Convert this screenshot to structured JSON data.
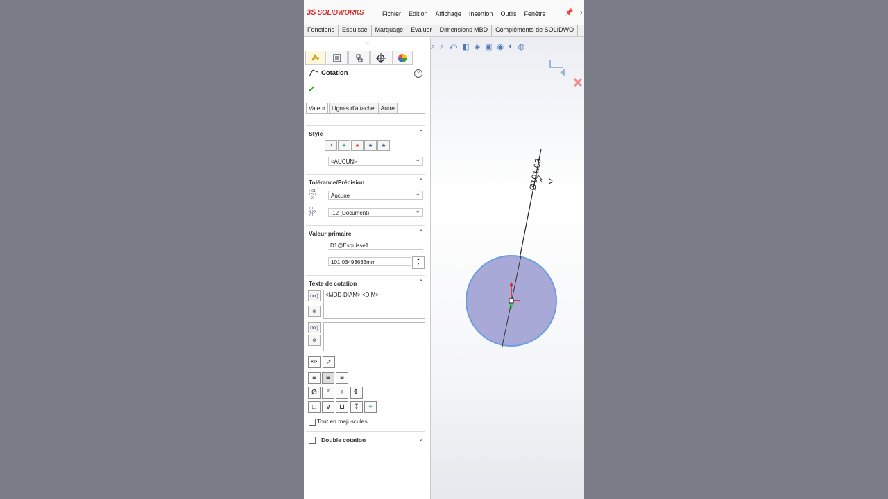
{
  "app": {
    "brand": "SOLIDWORKS",
    "brand_mark": "3S"
  },
  "menu": [
    "Fichier",
    "Edition",
    "Affichage",
    "Insertion",
    "Outils",
    "Fenêtre"
  ],
  "command_tabs": [
    "Fonctions",
    "Esquisse",
    "Marquage",
    "Evaluer",
    "Dimensions MBD",
    "Compléments de SOLIDWO"
  ],
  "property_manager": {
    "title": "Cotation",
    "tabs": [
      "Valeur",
      "Lignes d'attache",
      "Autre"
    ],
    "style": {
      "title": "Style",
      "selected": "<AUCUN>"
    },
    "tolerance": {
      "title": "Tolérance/Précision",
      "tolerance_value": "Aucune",
      "precision_value": ".12 (Document)"
    },
    "primary": {
      "title": "Valeur primaire",
      "name": "D1@Esquisse1",
      "value": "101.03493633mm"
    },
    "dim_text": {
      "title": "Texte de cotation",
      "text": "<MOD-DIAM> <DIM>"
    },
    "uppercase_label": "Tout en majuscules",
    "double": {
      "title": "Double cotation"
    }
  },
  "canvas": {
    "dimension_label": "Ø101.03",
    "diameter_value": 101.03
  },
  "colors": {
    "accent": "#d32f2f",
    "circle_fill": "#a9a9d8",
    "circle_stroke": "#6a9ee0",
    "ok": "#2e9b2e"
  },
  "icons": [
    "pin-icon",
    "help-icon",
    "ok-check-icon",
    "feature-manager-icon",
    "property-manager-icon",
    "configuration-icon",
    "dim-xpert-icon",
    "display-icon",
    "diameter-symbol-icon",
    "degree-symbol-icon",
    "plus-minus-icon",
    "centerline-symbol-icon",
    "square-icon",
    "countersink-icon",
    "counterbore-icon",
    "depth-icon",
    "more-symbols-icon"
  ]
}
